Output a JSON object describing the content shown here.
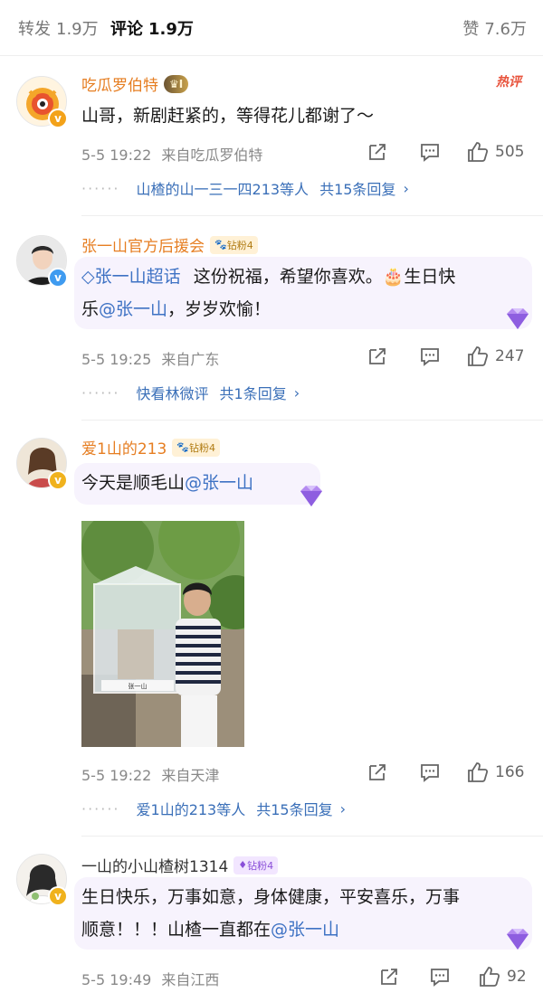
{
  "tabs": {
    "repost": {
      "label": "转发",
      "count": "1.9万"
    },
    "comment": {
      "label": "评论",
      "count": "1.9万"
    },
    "like": {
      "label": "赞",
      "count": "7.6万"
    }
  },
  "comments": [
    {
      "username": "吃瓜罗伯特",
      "crown_level": "I",
      "hot_tag": "热评",
      "text": "山哥，新剧赶紧的，等得花儿都谢了～",
      "time": "5-5 19:22",
      "source": "来自吃瓜罗伯特",
      "likes": "505",
      "replies_users": "山楂的山一三一四213等人",
      "replies_count": "共15条回复"
    },
    {
      "username": "张一山官方后援会",
      "fan_badge": "钻粉4",
      "topic": "张一山超话",
      "text_a": "这份祝福，希望你喜欢。",
      "text_b": "生日快",
      "text_c": "乐",
      "mention": "@张一山",
      "text_d": "，岁岁欢愉！",
      "time": "5-5 19:25",
      "source": "来自广东",
      "likes": "247",
      "replies_users": "快看林微评",
      "replies_count": "共1条回复"
    },
    {
      "username": "爱1山的213",
      "fan_badge": "钻粉4",
      "text": "今天是顺毛山",
      "mention": "@张一山",
      "photo_brand": "张一山",
      "time": "5-5 19:22",
      "source": "来自天津",
      "likes": "166",
      "replies_users": "爱1山的213等人",
      "replies_count": "共15条回复"
    },
    {
      "username": "一山的小山楂树1314",
      "fan_badge": "钻粉4",
      "text_line1": "生日快乐，万事如意，身体健康，平安喜乐，万事",
      "text_line2": "顺意！！！山楂一直都在",
      "mention": "@张一山",
      "time": "5-5 19:49",
      "source": "来自江西",
      "likes": "92"
    }
  ],
  "icons": {
    "share": "share-icon",
    "comment": "comment-icon",
    "like": "thumbs-up-icon",
    "chevron": "chevron-right-icon",
    "gem": "diamond-gem-icon"
  },
  "colors": {
    "username_gold": "#e67e22",
    "link_blue": "#3a6fb8",
    "hot_red": "#e8533c",
    "fan_purple": "#8a4fd8"
  }
}
